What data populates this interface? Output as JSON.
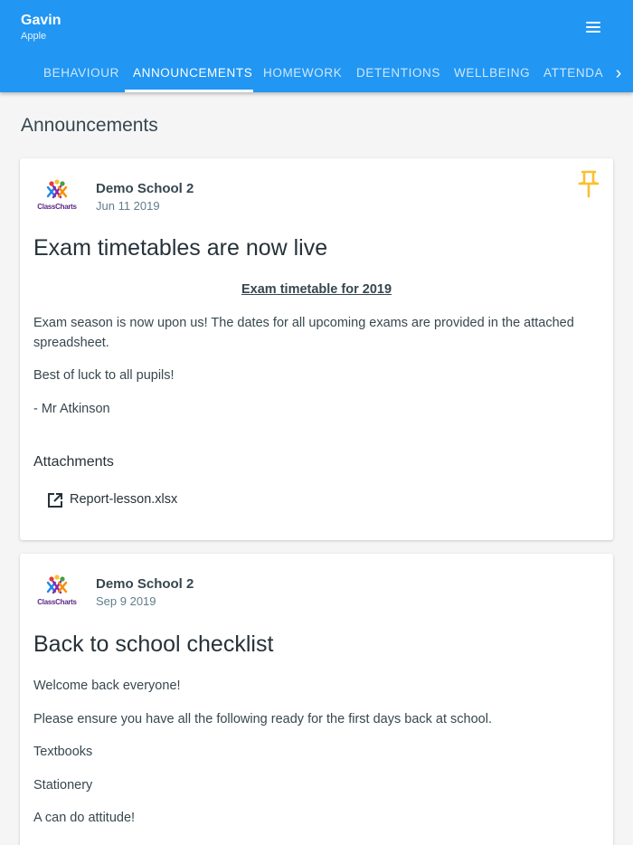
{
  "appbar": {
    "user_name": "Gavin",
    "user_subtitle": "Apple",
    "menu_icon": "hamburger-menu-icon",
    "background_color": "#2196f3"
  },
  "tabs": [
    {
      "label": "BEHAVIOUR",
      "active": false
    },
    {
      "label": "ANNOUNCEMENTS",
      "active": true
    },
    {
      "label": "HOMEWORK",
      "active": false
    },
    {
      "label": "DETENTIONS",
      "active": false
    },
    {
      "label": "WELLBEING",
      "active": false
    },
    {
      "label": "ATTENDA",
      "active": false
    }
  ],
  "tabs_scroll_icon": "chevron-right-icon",
  "page": {
    "title": "Announcements"
  },
  "announcements": [
    {
      "logo_text": "ClassCharts",
      "school": "Demo School 2",
      "date": "Jun 11 2019",
      "pinned": true,
      "pin_color": "#fbc02d",
      "title": "Exam timetables are now live",
      "subheading": "Exam timetable for 2019",
      "paragraphs": [
        "Exam season is now upon us! The dates for all upcoming exams are provided in the attached spreadsheet.",
        "Best of luck to all pupils!",
        "- Mr Atkinson"
      ],
      "attachments_title": "Attachments",
      "attachments": [
        {
          "icon": "open-in-new-icon",
          "label": "Report-lesson.xlsx"
        }
      ]
    },
    {
      "logo_text": "ClassCharts",
      "school": "Demo School 2",
      "date": "Sep 9 2019",
      "pinned": false,
      "title": "Back to school checklist",
      "paragraphs": [
        "Welcome back everyone!",
        "Please ensure you have all the following ready for the first days back at school.",
        "Textbooks",
        "Stationery",
        "A can do attitude!"
      ]
    }
  ]
}
